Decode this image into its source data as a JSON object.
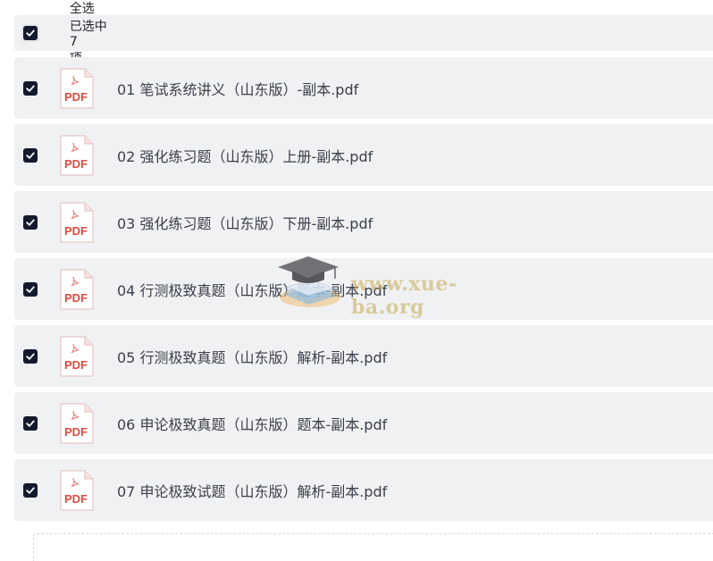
{
  "header": {
    "select_all": "全选",
    "selected_prefix": "已选中",
    "selected_count": "7",
    "selected_suffix": "项",
    "checked": true
  },
  "files": [
    {
      "name": "01 笔试系统讲义（山东版）-副本.pdf",
      "icon_label": "PDF",
      "checked": true
    },
    {
      "name": "02 强化练习题（山东版）上册-副本.pdf",
      "icon_label": "PDF",
      "checked": true
    },
    {
      "name": "03 强化练习题（山东版）下册-副本.pdf",
      "icon_label": "PDF",
      "checked": true
    },
    {
      "name": "04 行测极致真题（山东版）题本-副本.pdf",
      "icon_label": "PDF",
      "checked": true
    },
    {
      "name": "05 行测极致真题（山东版）解析-副本.pdf",
      "icon_label": "PDF",
      "checked": true
    },
    {
      "name": "06 申论极致真题（山东版）题本-副本.pdf",
      "icon_label": "PDF",
      "checked": true
    },
    {
      "name": "07 申论极致试题（山东版）解析-副本.pdf",
      "icon_label": "PDF",
      "checked": true
    }
  ],
  "watermark": {
    "text": "www.xue-ba.org",
    "icon": "graduation-cap-books-icon"
  },
  "colors": {
    "row_bg": "#f0f1f3",
    "checkbox": "#141a2e",
    "pdf_red": "#e04a3f",
    "text": "#3a3f4a"
  }
}
